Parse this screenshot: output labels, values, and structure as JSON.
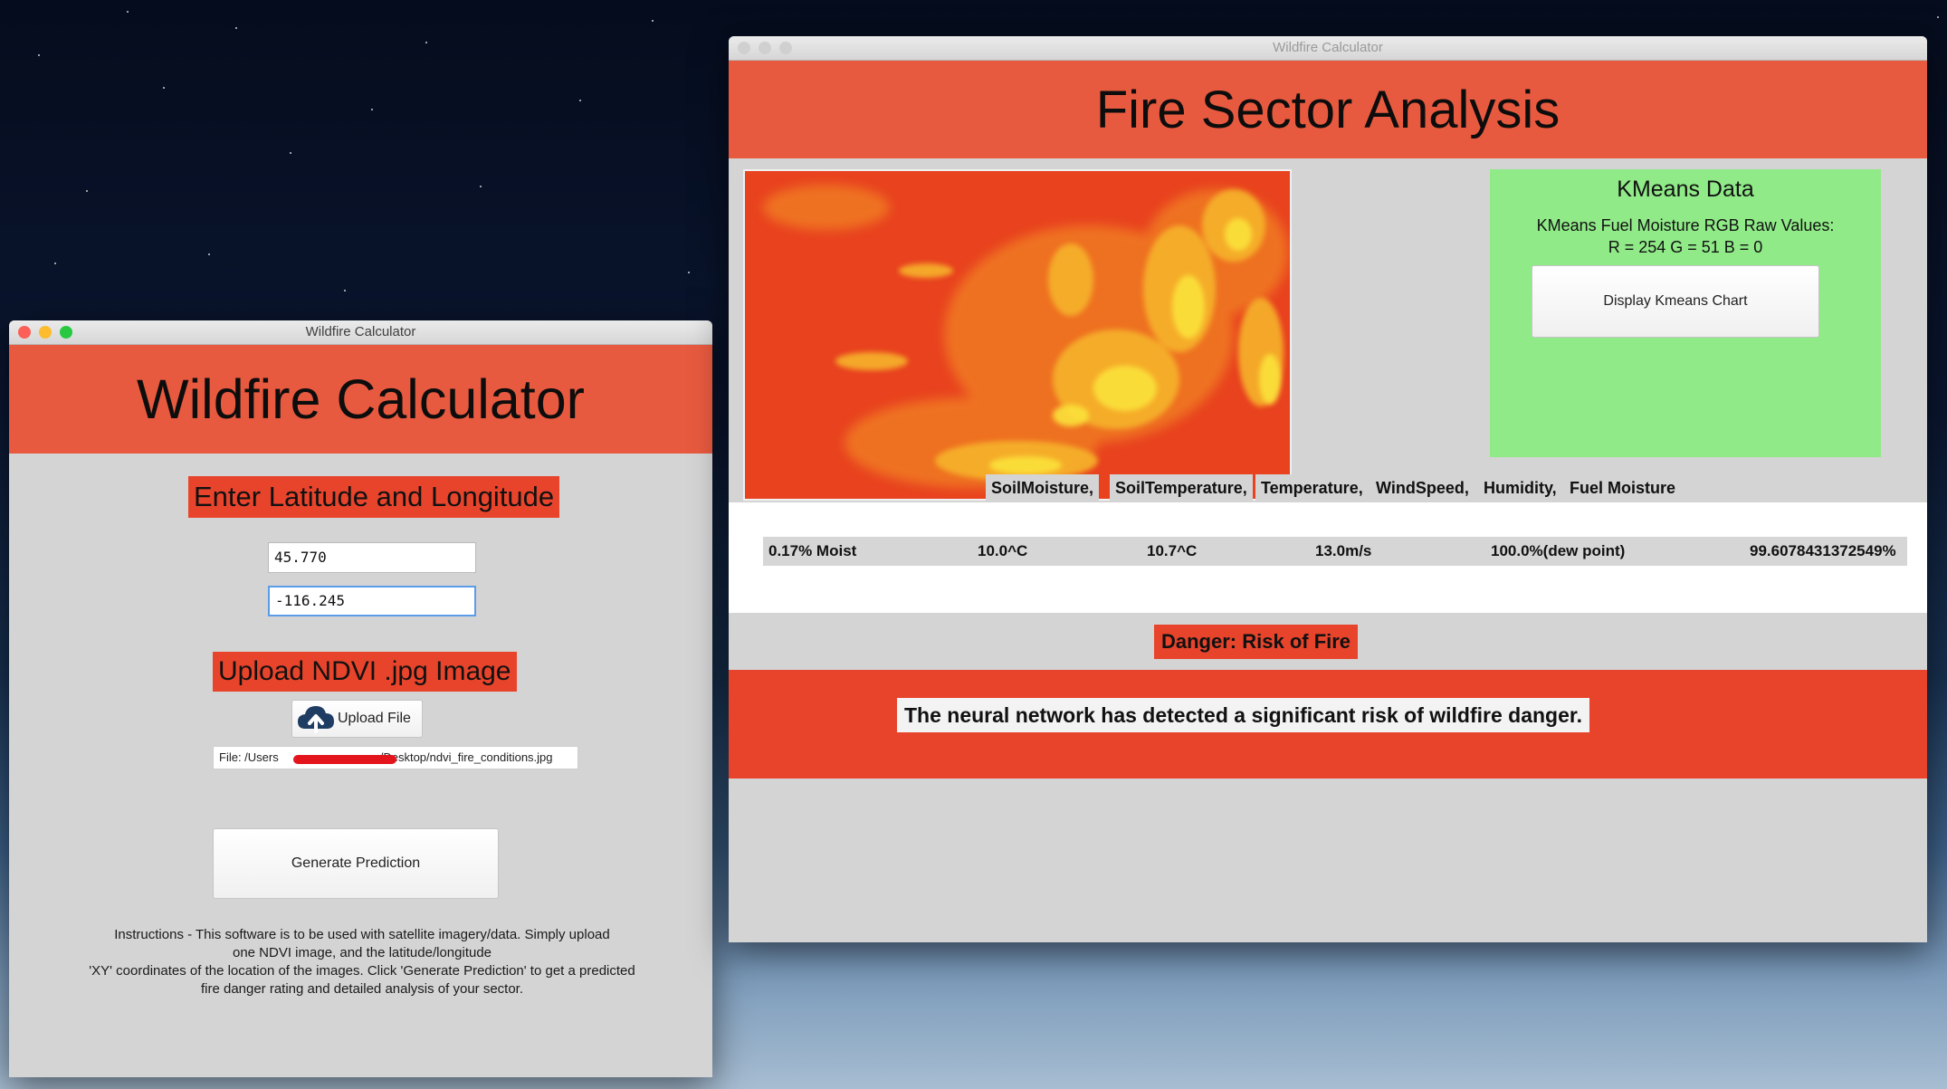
{
  "left_window": {
    "title": "Wildfire Calculator",
    "header": "Wildfire Calculator",
    "latlon_label": "Enter Latitude and Longitude",
    "latitude_value": "45.770",
    "longitude_value": "-116.245",
    "upload_label": "Upload NDVI .jpg Image",
    "upload_button": "Upload File",
    "file_path_prefix": "File: /Users",
    "file_path_suffix": "/Desktop/ndvi_fire_conditions.jpg",
    "generate_button": "Generate Prediction",
    "instructions": [
      "Instructions - This software is to be used with satellite imagery/data. Simply upload",
      "one NDVI image, and the latitude/longitude",
      "'XY' coordinates of the location of the images. Click 'Generate Prediction' to get a predicted",
      "fire danger rating and detailed analysis of your sector."
    ]
  },
  "right_window": {
    "title": "Wildfire Calculator",
    "header": "Fire Sector Analysis",
    "kmeans": {
      "title": "KMeans Data",
      "raw_label": "KMeans Fuel Moisture RGB Raw Values:",
      "rgb_values": "R = 254  G = 51  B = 0",
      "chart_button": "Display Kmeans Chart"
    },
    "metric_headers": [
      "SoilMoisture,",
      "SoilTemperature,",
      "Temperature,",
      "WindSpeed,",
      "Humidity,",
      "Fuel Moisture"
    ],
    "metric_values": [
      "0.17% Moist",
      "10.0^C",
      "10.7^C",
      "13.0m/s",
      "100.0%(dew point)",
      "99.6078431372549%"
    ],
    "danger": "Danger: Risk of Fire",
    "message": "The neural network has detected a significant risk of wildfire danger."
  },
  "colors": {
    "header_orange": "#e85a3f",
    "label_red": "#e8442c",
    "kmeans_green": "#90ea88",
    "window_gray": "#d4d4d4"
  },
  "icons": {
    "upload": "cloud-upload-icon"
  }
}
